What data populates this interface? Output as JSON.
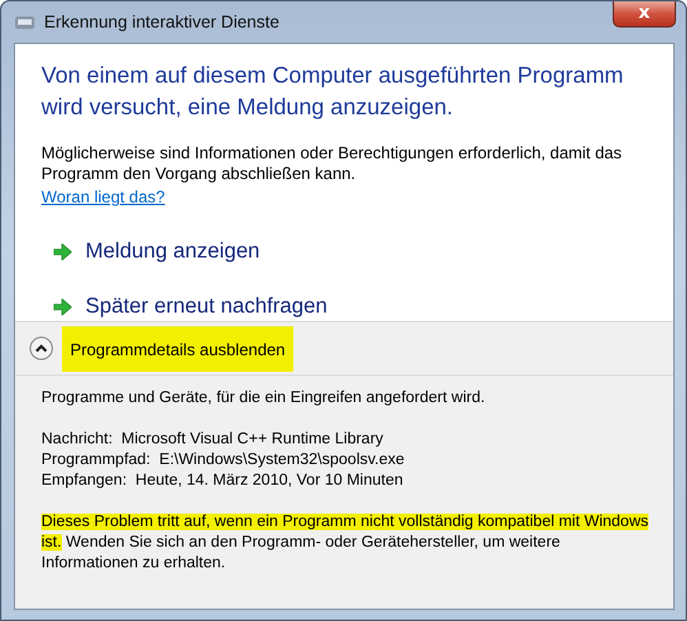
{
  "window": {
    "title": "Erkennung interaktiver Dienste",
    "close_label": "x"
  },
  "heading": "Von einem auf diesem Computer ausgeführten Programm wird versucht, eine Meldung anzuzeigen.",
  "description": "Möglicherweise sind Informationen oder Berechtigungen erforderlich, damit das Programm den Vorgang abschließen kann.",
  "help_link": "Woran liegt das?",
  "commands": [
    {
      "label": "Meldung anzeigen"
    },
    {
      "label": "Später erneut nachfragen"
    }
  ],
  "details_toggle": {
    "label": "Programmdetails ausblenden",
    "expanded": true,
    "highlighted": true
  },
  "details": {
    "intro": "Programme und Geräte, für die ein Eingreifen angefordert wird.",
    "fields": [
      {
        "label": "Nachricht:",
        "value": "Microsoft Visual C++ Runtime Library"
      },
      {
        "label": "Programmpfad:",
        "value": "E:\\Windows\\System32\\spoolsv.exe"
      },
      {
        "label": "Empfangen:",
        "value": "Heute, 14. März 2010, Vor 10 Minuten"
      }
    ],
    "note": [
      {
        "text": "Dieses Problem tritt auf, wenn ein Programm nicht vollständig kompatibel mit Windows ist.",
        "highlighted": true
      },
      {
        "text": " Wenden Sie sich an den Programm- oder Gerätehersteller, um weitere Informationen zu erhalten.",
        "highlighted": false
      }
    ]
  }
}
